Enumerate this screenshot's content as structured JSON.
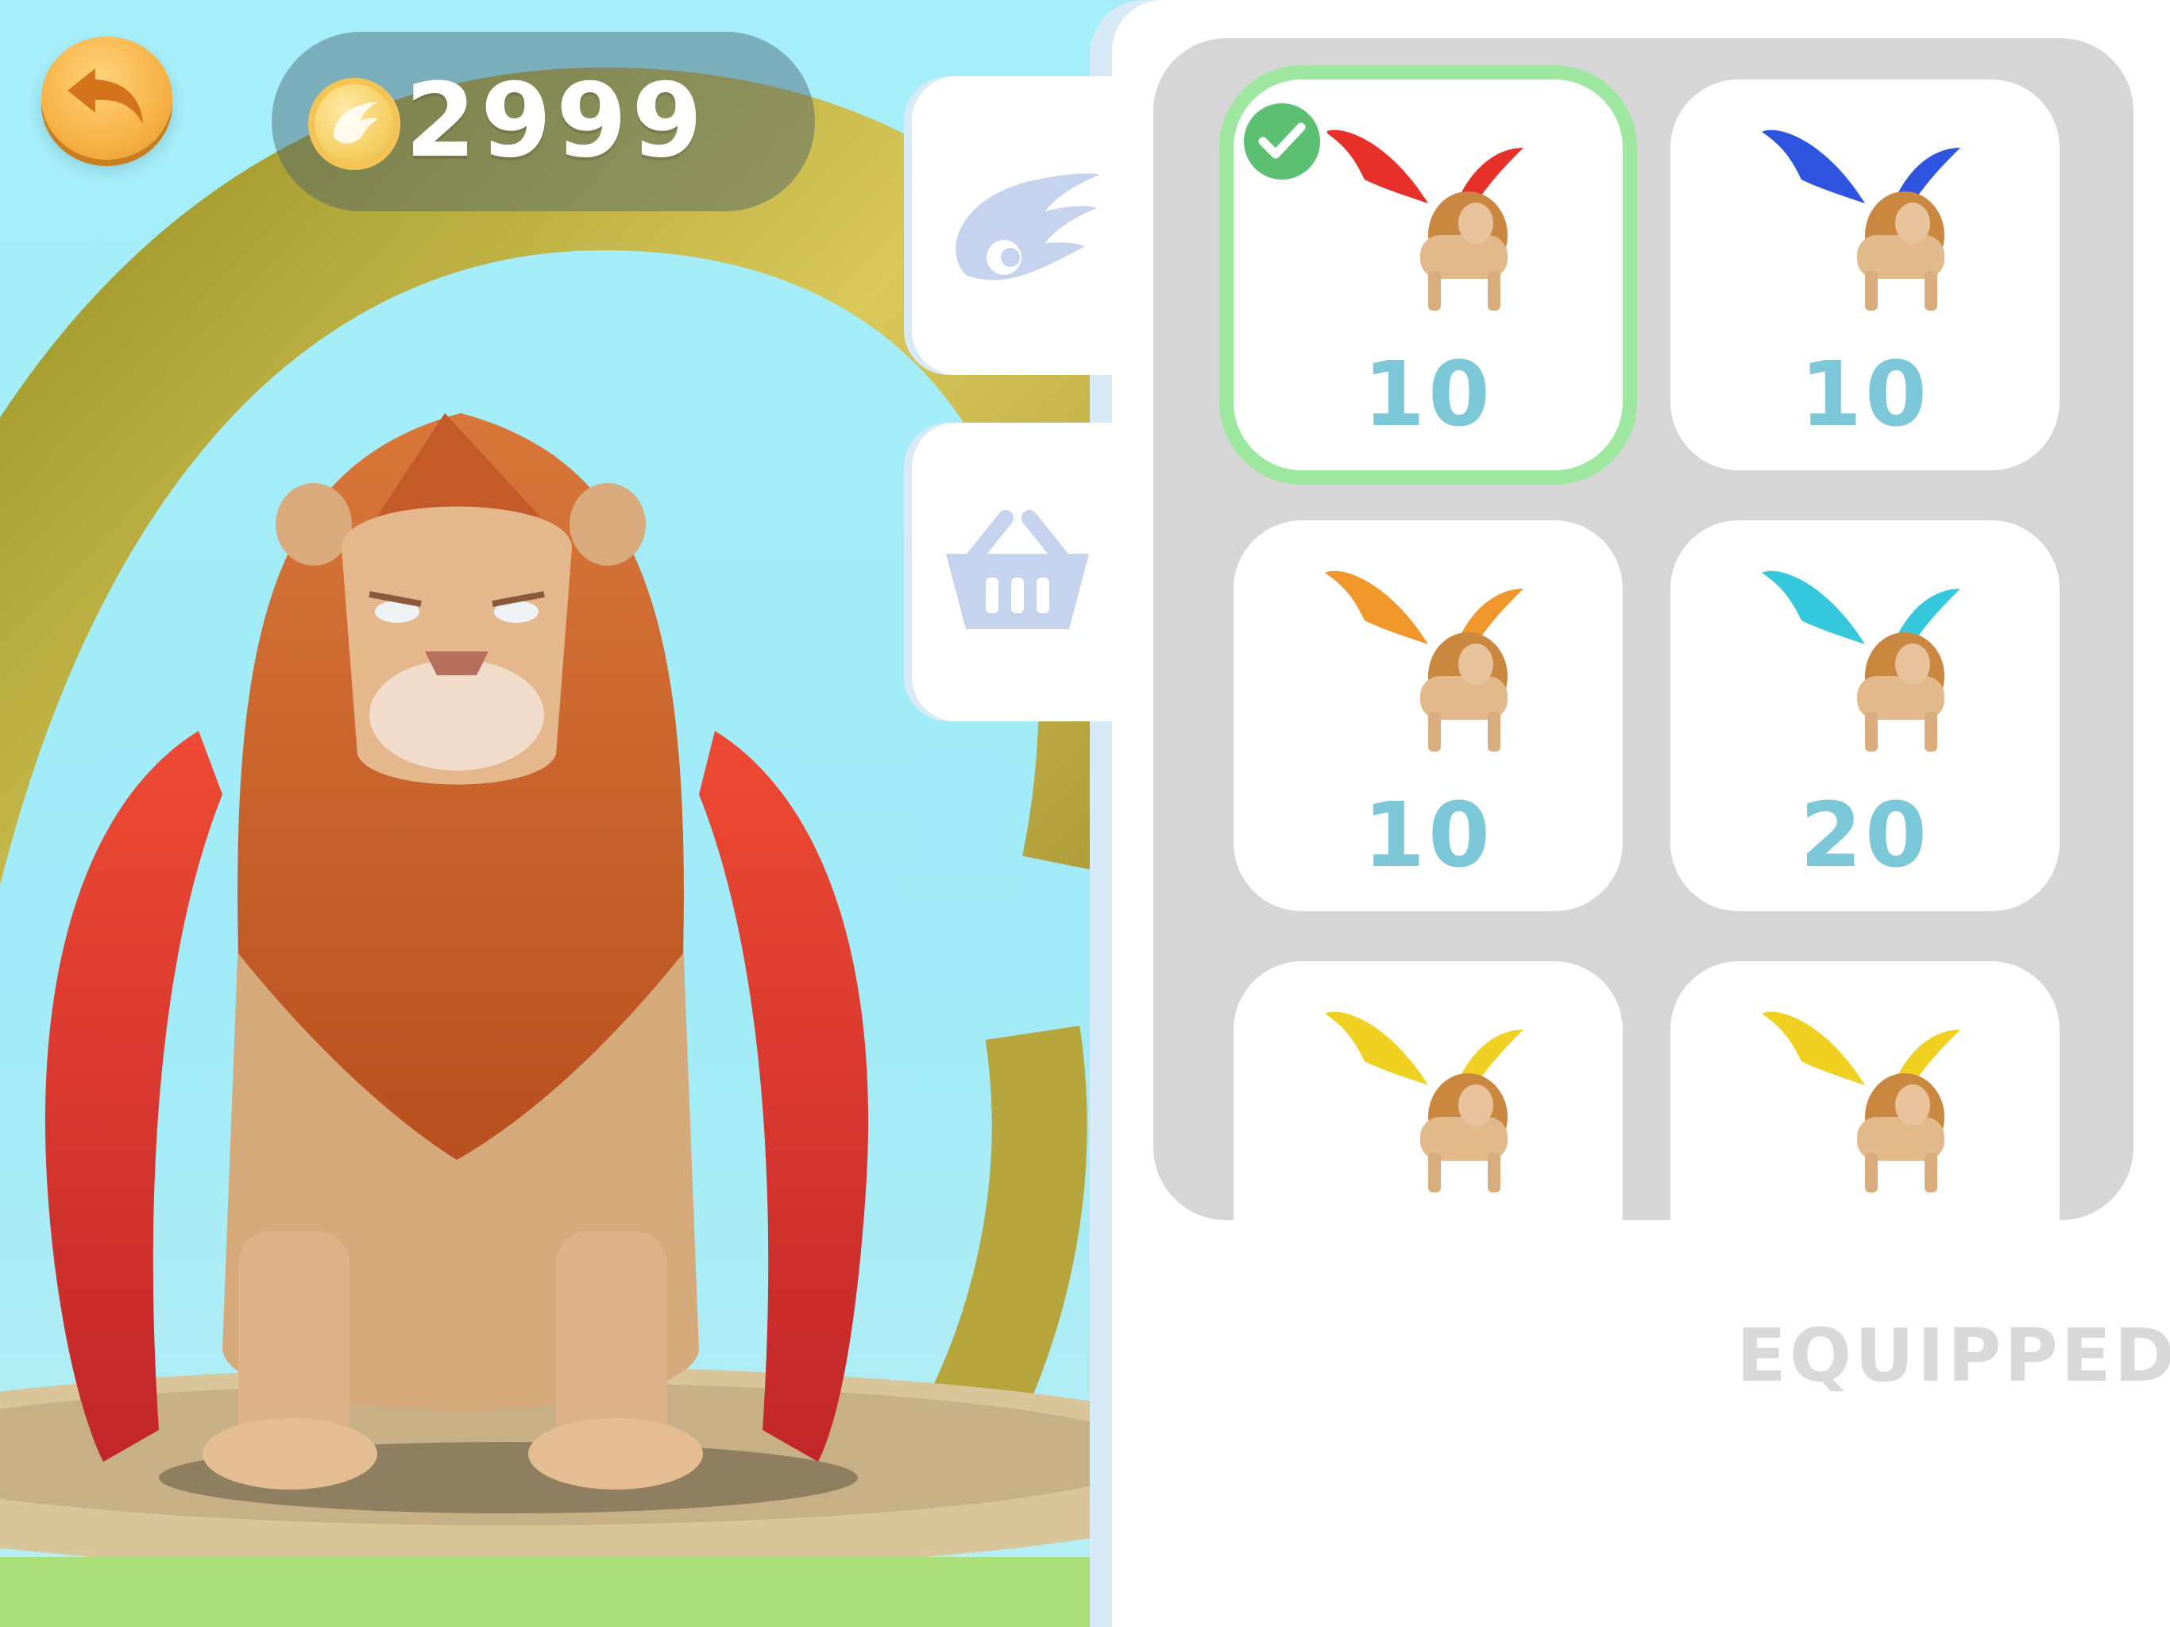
{
  "hud": {
    "coins": "2999"
  },
  "shop": {
    "tabs": [
      {
        "icon": "wing-icon"
      },
      {
        "icon": "basket-icon"
      }
    ],
    "items": [
      {
        "price": "10",
        "wing_color": "#e8302a",
        "selected": true
      },
      {
        "price": "10",
        "wing_color": "#2f55e0",
        "selected": false
      },
      {
        "price": "10",
        "wing_color": "#f0962a",
        "selected": false
      },
      {
        "price": "20",
        "wing_color": "#35c8dc",
        "selected": false
      },
      {
        "price": "",
        "wing_color": "#f0d020",
        "selected": false
      },
      {
        "price": "",
        "wing_color": "#f0d020",
        "selected": false
      }
    ],
    "status_label": "EQUIPPED"
  },
  "colors": {
    "accent_price": "#7cc8d8",
    "selected_border": "#9de7a0",
    "check_badge": "#5cc072",
    "back_button": "#f7b246"
  }
}
